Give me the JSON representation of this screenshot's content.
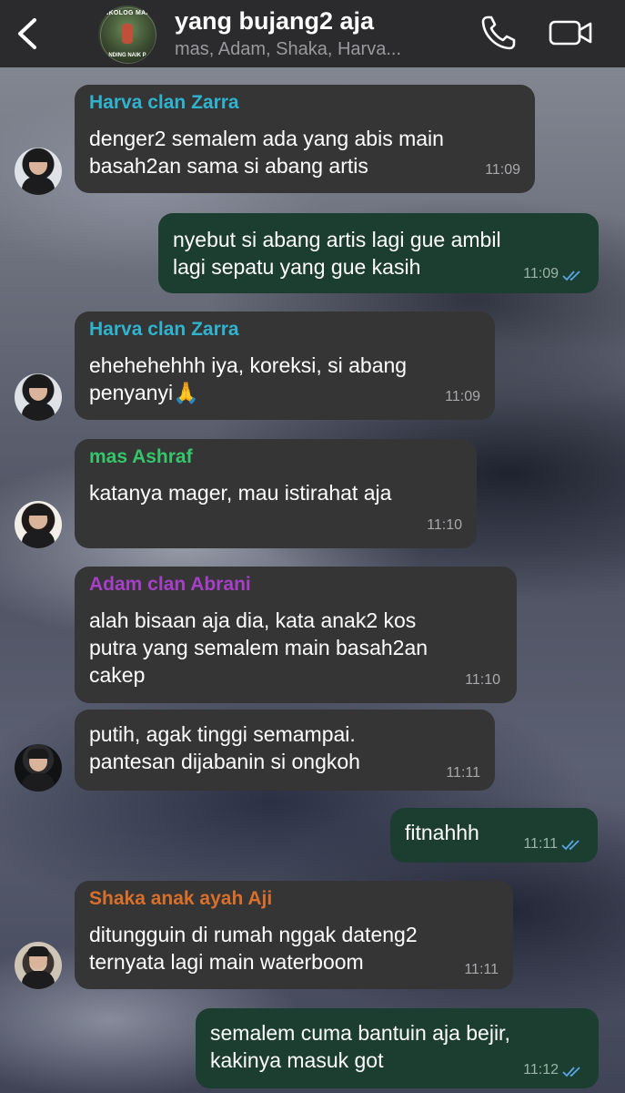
{
  "header": {
    "title": "yang bujang2 aja",
    "subtitle": "mas, Adam, Shaka, Harva...",
    "avatar_text_top": "NKOLOG MAH",
    "avatar_text_bottom": "NDING NAIK P"
  },
  "colors": {
    "bubble_in": "#353536",
    "bubble_out": "#1c3e31",
    "sender_harva": "#2fb3cf",
    "sender_ashraf": "#35c66a",
    "sender_adam": "#a73fc8",
    "sender_shaka": "#d86f2a",
    "read_ticks": "#5aa7e6"
  },
  "messages": [
    {
      "sender": "Harva clan Zarra",
      "lines": [
        "denger2 semalem ada yang abis main",
        "basah2an sama si abang artis"
      ],
      "time": "11:09"
    },
    {
      "lines": [
        "nyebut si abang artis lagi gue ambil",
        "lagi sepatu yang gue kasih"
      ],
      "time": "11:09"
    },
    {
      "sender": "Harva clan Zarra",
      "lines": [
        "ehehehehhh iya, koreksi, si abang",
        "penyanyi🙏"
      ],
      "time": "11:09"
    },
    {
      "sender": "mas Ashraf",
      "lines": [
        "katanya mager, mau istirahat aja"
      ],
      "time": "11:10"
    },
    {
      "sender": "Adam clan Abrani",
      "lines": [
        "alah bisaan aja dia, kata anak2 kos",
        "putra yang semalem main basah2an",
        "cakep"
      ],
      "time": "11:10"
    },
    {
      "lines": [
        "putih, agak tinggi semampai.",
        "pantesan dijabanin si ongkoh"
      ],
      "time": "11:11"
    },
    {
      "lines": [
        "fitnahhh"
      ],
      "time": "11:11"
    },
    {
      "sender": "Shaka anak ayah Aji",
      "lines": [
        "ditungguin di rumah nggak dateng2",
        "ternyata lagi main waterboom"
      ],
      "time": "11:11"
    },
    {
      "lines": [
        "semalem cuma bantuin aja bejir,",
        "kakinya masuk got"
      ],
      "time": "11:12"
    }
  ]
}
